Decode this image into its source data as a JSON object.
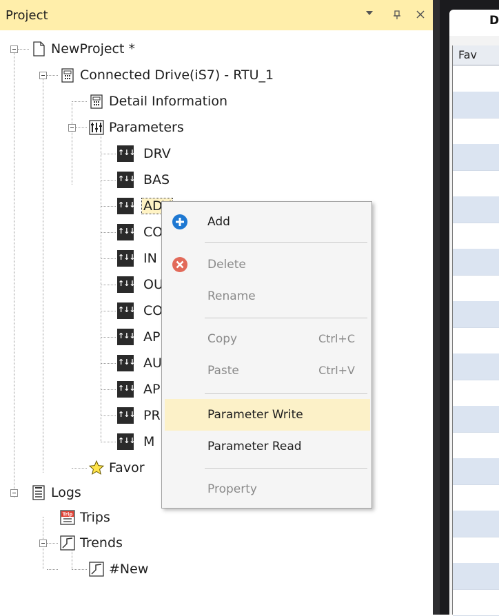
{
  "panel": {
    "title": "Project",
    "controls": {
      "dropdown": "▾",
      "pin": "ᵽ",
      "close": "✕"
    }
  },
  "tree": {
    "project": "NewProject *",
    "drive": "Connected Drive(iS7) - RTU_1",
    "detail": "Detail Information",
    "parameters": "Parameters",
    "groups": [
      "DRV",
      "BAS",
      "ADV",
      "CO",
      "IN",
      "OU",
      "CO",
      "AP",
      "AU",
      "AP",
      "PR",
      "M"
    ],
    "favorites": "Favor",
    "logs": "Logs",
    "trips": "Trips",
    "trip_badge": "Trip",
    "trends": "Trends",
    "trend_new": "#New"
  },
  "doc": {
    "tab_label": "D",
    "column_header": "Fav"
  },
  "context_menu": {
    "items": [
      {
        "label": "Add",
        "shortcut": "",
        "icon": "add-icon",
        "enabled": true
      },
      {
        "label": "Delete",
        "shortcut": "",
        "icon": "delete-icon",
        "enabled": false
      },
      {
        "label": "Rename",
        "shortcut": "",
        "enabled": false
      },
      {
        "label": "Copy",
        "shortcut": "Ctrl+C",
        "enabled": false
      },
      {
        "label": "Paste",
        "shortcut": "Ctrl+V",
        "enabled": false
      },
      {
        "label": "Parameter Write",
        "shortcut": "",
        "enabled": true,
        "highlighted": true
      },
      {
        "label": "Parameter Read",
        "shortcut": "",
        "enabled": true
      },
      {
        "label": "Property",
        "shortcut": "",
        "enabled": false
      }
    ]
  },
  "colors": {
    "header_bg": "#ffeeaa",
    "menu_hover": "#fcf1c8",
    "add_blue": "#1e78d2",
    "delete_red": "#e26a5a"
  }
}
